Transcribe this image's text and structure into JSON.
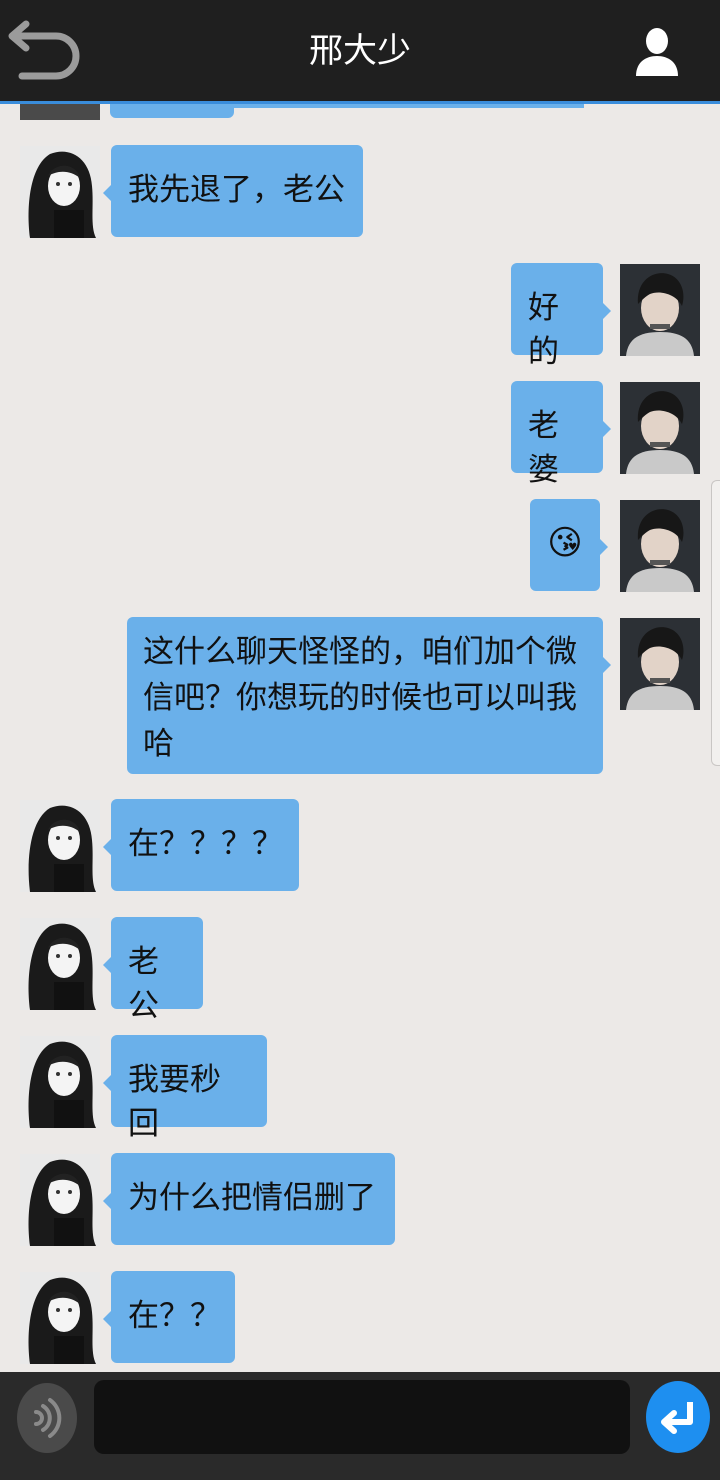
{
  "header": {
    "title": "邢大少"
  },
  "messages": [
    {
      "side": "left",
      "text": "我先退了，老公"
    },
    {
      "side": "right",
      "text": "好的"
    },
    {
      "side": "right",
      "text": "老婆"
    },
    {
      "side": "right",
      "emoji": "😘"
    },
    {
      "side": "right",
      "lines": [
        "这什么聊天怪怪的，咱们加个微",
        "信吧？你想玩的时候也可以叫我",
        "哈"
      ]
    },
    {
      "side": "left",
      "text": "在？？？？"
    },
    {
      "side": "left",
      "text": "老公"
    },
    {
      "side": "left",
      "text": "我要秒回"
    },
    {
      "side": "left",
      "text": "为什么把情侣删了"
    },
    {
      "side": "left",
      "text": "在？？"
    }
  ],
  "composer": {
    "value": "",
    "placeholder": ""
  },
  "icons": {
    "back": "back-arrow-icon",
    "profile": "person-icon",
    "voice": "voice-icon",
    "send": "enter-icon"
  },
  "colors": {
    "header_bg": "#1f1f1f",
    "header_accent": "#3a8ddb",
    "bubble": "#6ab0ea",
    "chat_bg": "#ece9e7",
    "send_button": "#1e8ff0"
  }
}
